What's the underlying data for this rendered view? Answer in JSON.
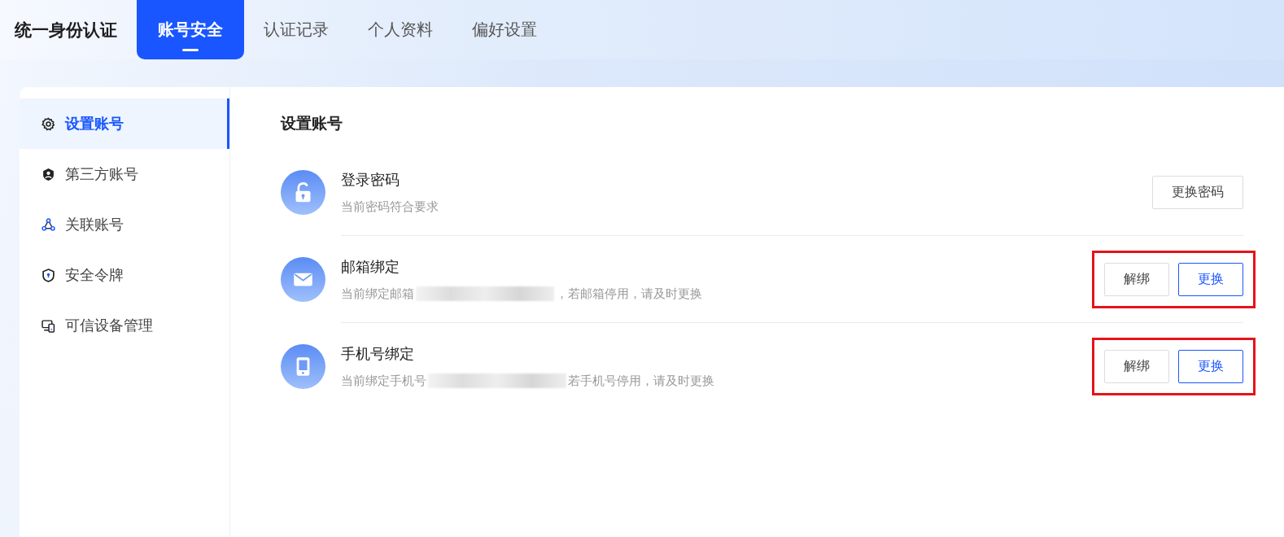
{
  "header": {
    "title": "统一身份认证",
    "tabs": [
      {
        "label": "账号安全",
        "selected": true
      },
      {
        "label": "认证记录",
        "selected": false
      },
      {
        "label": "个人资料",
        "selected": false
      },
      {
        "label": "偏好设置",
        "selected": false
      }
    ]
  },
  "sidebar": {
    "items": [
      {
        "label": "设置账号",
        "selected": true
      },
      {
        "label": "第三方账号",
        "selected": false
      },
      {
        "label": "关联账号",
        "selected": false
      },
      {
        "label": "安全令牌",
        "selected": false
      },
      {
        "label": "可信设备管理",
        "selected": false
      }
    ]
  },
  "content": {
    "title": "设置账号",
    "rows": [
      {
        "title": "登录密码",
        "description": "当前密码符合要求",
        "redacted": false,
        "highlighted": false,
        "buttons": [
          {
            "label": "更换密码",
            "kind": "default"
          }
        ]
      },
      {
        "title": "邮箱绑定",
        "description": "当前绑定邮箱",
        "redacted": true,
        "description_after": "，若邮箱停用，请及时更换",
        "highlighted": true,
        "buttons": [
          {
            "label": "解绑",
            "kind": "default"
          },
          {
            "label": "更换",
            "kind": "primary"
          }
        ]
      },
      {
        "title": "手机号绑定",
        "description": "当前绑定手机号",
        "redacted": true,
        "description_after": "若手机号停用，请及时更换",
        "highlighted": true,
        "buttons": [
          {
            "label": "解绑",
            "kind": "default"
          },
          {
            "label": "更换",
            "kind": "primary"
          }
        ]
      }
    ]
  }
}
